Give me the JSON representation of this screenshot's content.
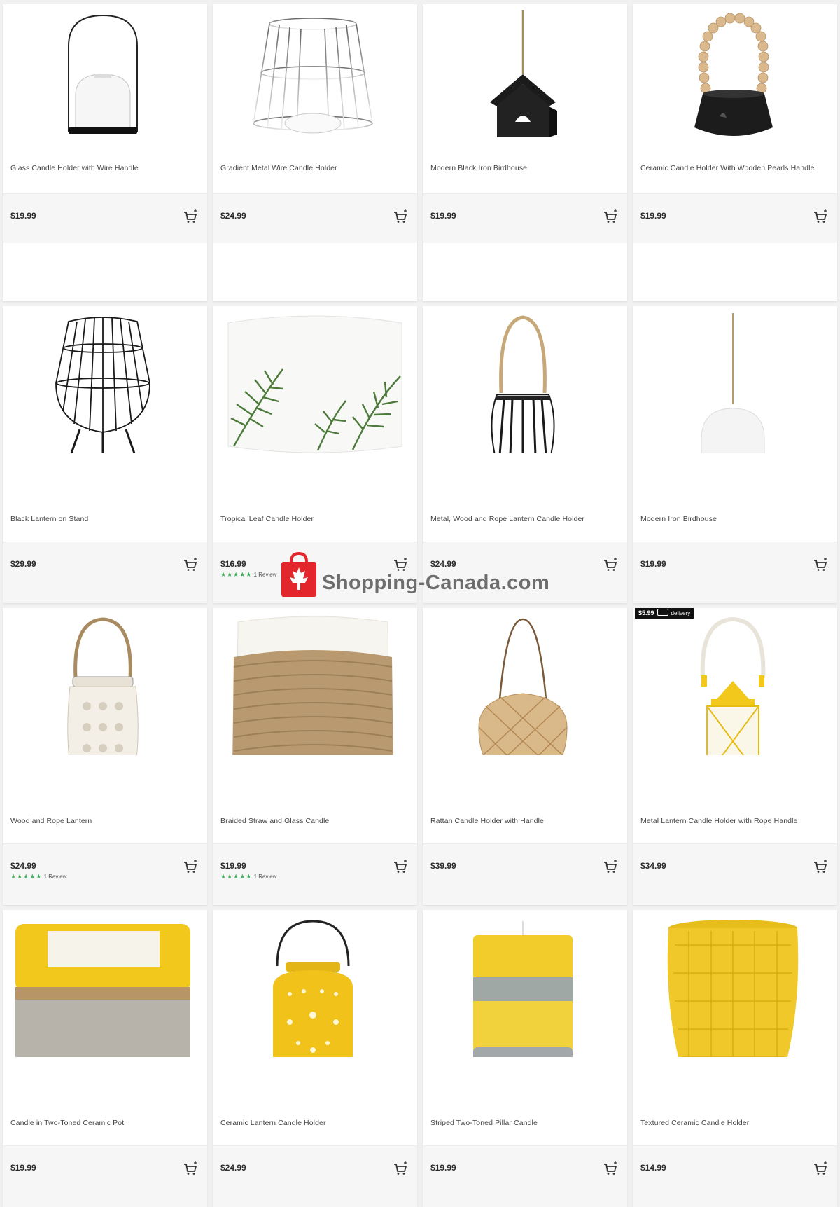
{
  "products": [
    {
      "title": "Glass Candle Holder with Wire Handle",
      "price": "$19.99",
      "icon": "glass-dome-candle-image"
    },
    {
      "title": "Gradient Metal Wire Candle Holder",
      "price": "$24.99",
      "icon": "wire-candle-holder-image"
    },
    {
      "title": "Modern Black Iron Birdhouse",
      "price": "$19.99",
      "icon": "black-birdhouse-image"
    },
    {
      "title": "Ceramic Candle Holder With Wooden Pearls Handle",
      "price": "$19.99",
      "icon": "ceramic-pearl-handle-image"
    },
    {
      "title": "Black Lantern on Stand",
      "price": "$29.99",
      "icon": "black-lantern-stand-image"
    },
    {
      "title": "Tropical Leaf Candle Holder",
      "price": "$16.99",
      "stars": "★★★★★",
      "reviews": "1 Review",
      "icon": "tropical-leaf-image"
    },
    {
      "title": "Metal, Wood and Rope Lantern Candle Holder",
      "price": "$24.99",
      "icon": "rope-lantern-image"
    },
    {
      "title": "Modern Iron Birdhouse",
      "price": "$19.99",
      "icon": "white-birdhouse-image"
    },
    {
      "title": "Wood and Rope Lantern",
      "price": "$24.99",
      "stars": "★★★★★",
      "reviews": "1 Review",
      "icon": "wood-lantern-image"
    },
    {
      "title": "Braided Straw and Glass Candle",
      "price": "$19.99",
      "stars": "★★★★★",
      "reviews": "1 Review",
      "icon": "braided-straw-candle-image"
    },
    {
      "title": "Rattan Candle Holder with Handle",
      "price": "$39.99",
      "icon": "rattan-holder-image"
    },
    {
      "title": "Metal Lantern Candle Holder with Rope Handle",
      "price": "$34.99",
      "icon": "yellow-lantern-image",
      "badge": {
        "price": "$5.99",
        "label": "delivery"
      }
    },
    {
      "title": "Candle in Two-Toned Ceramic Pot",
      "price": "$19.99",
      "icon": "two-tone-pot-image"
    },
    {
      "title": "Ceramic Lantern Candle Holder",
      "price": "$24.99",
      "icon": "yellow-ceramic-lantern-image"
    },
    {
      "title": "Striped Two-Toned Pillar Candle",
      "price": "$19.99",
      "icon": "striped-pillar-candle-image"
    },
    {
      "title": "Textured Ceramic Candle Holder",
      "price": "$14.99",
      "icon": "textured-yellow-holder-image"
    }
  ],
  "watermark": {
    "text": "Shopping-Canada.com"
  },
  "colors": {
    "star": "#3aaa5a",
    "yellow": "#f2c81c",
    "badge": "#111111"
  }
}
